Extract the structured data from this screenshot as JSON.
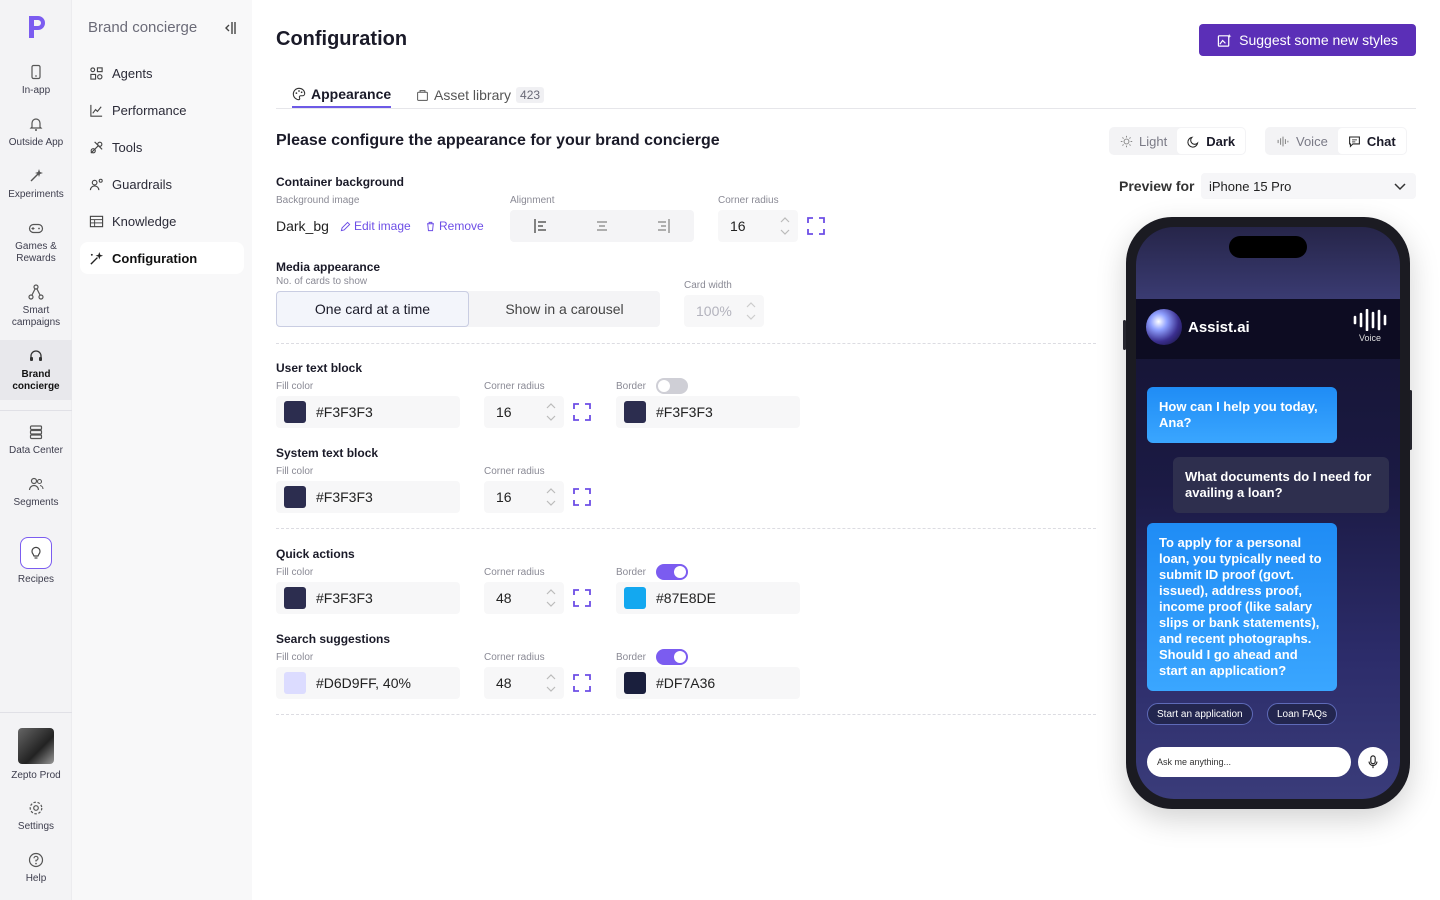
{
  "rail": {
    "items": [
      {
        "label": "In-app"
      },
      {
        "label": "Outside App"
      },
      {
        "label": "Experiments"
      },
      {
        "label": "Games &\nRewards"
      },
      {
        "label": "Smart\ncampaigns"
      },
      {
        "label": "Brand\nconcierge"
      },
      {
        "label": "Data Center"
      },
      {
        "label": "Segments"
      },
      {
        "label": "Recipes"
      }
    ],
    "profile": "Zepto Prod",
    "settings": "Settings",
    "help": "Help"
  },
  "sidenav": {
    "title": "Brand concierge",
    "items": [
      "Agents",
      "Performance",
      "Tools",
      "Guardrails",
      "Knowledge",
      "Configuration"
    ]
  },
  "header": {
    "title": "Configuration",
    "suggest_label": "Suggest some new styles"
  },
  "tabs": {
    "appearance": "Appearance",
    "asset_library": "Asset library",
    "asset_count": "423"
  },
  "form": {
    "subtitle": "Please configure the appearance for your brand concierge",
    "container": {
      "title": "Container background",
      "bg_label": "Background image",
      "bg_value": "Dark_bg",
      "edit": "Edit image",
      "remove": "Remove",
      "align_label": "Alignment",
      "radius_label": "Corner radius",
      "radius": "16"
    },
    "media": {
      "title": "Media appearance",
      "cards_label": "No. of cards to show",
      "opt1": "One card at a time",
      "opt2": "Show in a carousel",
      "width_label": "Card width",
      "width": "100%"
    },
    "labels": {
      "fill": "Fill color",
      "radius": "Corner radius",
      "border": "Border"
    },
    "user_block": {
      "title": "User text block",
      "fill": "#F3F3F3",
      "radius": "16",
      "border": "#F3F3F3",
      "fill_swatch": "#2c2d4f",
      "border_swatch": "#2c2d4f"
    },
    "system_block": {
      "title": "System text block",
      "fill": "#F3F3F3",
      "radius": "16",
      "fill_swatch": "#2c2d4f"
    },
    "quick_actions": {
      "title": "Quick actions",
      "fill": "#F3F3F3",
      "radius": "48",
      "border": "#87E8DE",
      "fill_swatch": "#2c2d4f",
      "border_swatch": "#13a8f0"
    },
    "search_suggestions": {
      "title": "Search suggestions",
      "fill": "#D6D9FF, 40%",
      "radius": "48",
      "border": "#DF7A36",
      "fill_swatch": "#dcdcff",
      "border_swatch": "#1a1f3d"
    }
  },
  "preview": {
    "theme": {
      "light": "Light",
      "dark": "Dark"
    },
    "mode": {
      "voice": "Voice",
      "chat": "Chat"
    },
    "label": "Preview for",
    "device": "iPhone 15 Pro",
    "bot_name": "Assist.ai",
    "voice_label": "Voice",
    "msg1": "How can I help you today, Ana?",
    "msg2": "What documents do I need for availing a loan?",
    "msg3": "To apply for a personal loan, you typically need to submit ID proof (govt. issued), address proof, income proof (like salary slips or bank statements), and recent photographs. Should I go ahead and start an application?",
    "quick1": "Start an application",
    "quick2": "Loan FAQs",
    "input_placeholder": "Ask me anything..."
  },
  "colors": {
    "accent": "#5b2fb7",
    "toggle_on": "#7b5cf0",
    "link": "#6d4ee6"
  }
}
